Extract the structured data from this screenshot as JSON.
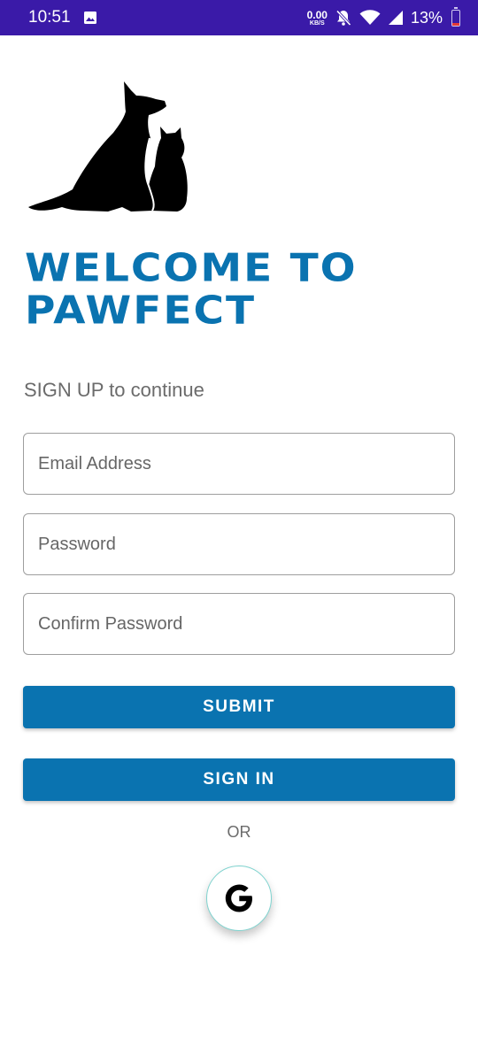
{
  "status_bar": {
    "time": "10:51",
    "net_speed_value": "0.00",
    "net_speed_unit": "KB/S",
    "battery": "13%"
  },
  "header": {
    "title_line1": "WELCOME TO",
    "title_line2": "PAWFECT",
    "subtitle": "SIGN UP to continue"
  },
  "form": {
    "email_placeholder": "Email Address",
    "password_placeholder": "Password",
    "confirm_placeholder": "Confirm Password"
  },
  "buttons": {
    "submit": "SUBMIT",
    "sign_in": "SIGN IN"
  },
  "divider": "OR",
  "social": {
    "google_icon": "google-icon"
  },
  "colors": {
    "status_bar": "#3a1aa8",
    "brand": "#0a73b0"
  }
}
